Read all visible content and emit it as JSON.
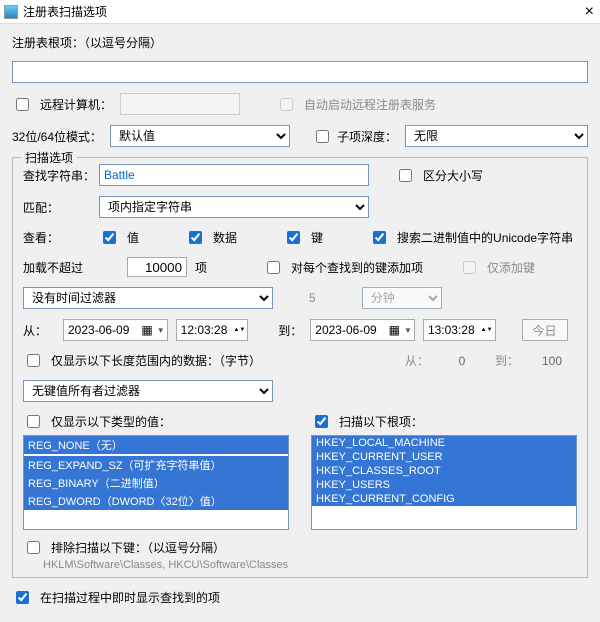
{
  "title": "注册表扫描选项",
  "root_label": "注册表根项：（以逗号分隔）",
  "root_value": "",
  "remote_label": "远程计算机：",
  "remote_value": "",
  "auto_remote_label": "自动启动远程注册表服务",
  "mode_label": "32位/64位模式：",
  "mode_value": "默认值",
  "child_depth_label": "子项深度：",
  "child_depth_value": "无限",
  "scan_group": "扫描选项",
  "search_label": "查找字符串：",
  "search_value": "Battle",
  "case_label": "区分大小写",
  "match_label": "匹配：",
  "match_value": "项内指定字符串",
  "look_label": "查看：",
  "look_values": "值",
  "look_data": "数据",
  "look_keys": "键",
  "unicode_label": "搜索二进制值中的Unicode字符串",
  "load_label": "加载不超过",
  "load_value": "10000",
  "load_unit": "项",
  "addkey_label": "对每个查找到的键添加项",
  "onlyadd_label": "仅添加键",
  "time_filter_value": "没有时间过滤器",
  "time_num": "5",
  "time_unit": "分钟",
  "from_label": "从：",
  "to_label": "到：",
  "date1": "2023-06-09",
  "time1": "12:03:28",
  "date2": "2023-06-09",
  "time2": "13:03:28",
  "today_btn": "今日",
  "size_label": "仅显示以下长度范围内的数据：（字节）",
  "size_from": "从：",
  "size_from_val": "0",
  "size_to": "到：",
  "size_to_val": "100",
  "owner_filter": "无键值所有者过滤器",
  "types_label": "仅显示以下类型的值：",
  "roots_label": "扫描以下根项：",
  "types": [
    "REG_NONE（无）",
    "",
    "REG_EXPAND_SZ（可扩充字符串值）",
    "REG_BINARY（二进制值）",
    "REG_DWORD（DWORD〈32位〉值）"
  ],
  "roots": [
    "HKEY_LOCAL_MACHINE",
    "HKEY_CURRENT_USER",
    "HKEY_CLASSES_ROOT",
    "HKEY_USERS",
    "HKEY_CURRENT_CONFIG"
  ],
  "exclude_label": "排除扫描以下键：（以逗号分隔）",
  "exclude_hint": "HKLM\\Software\\Classes, HKCU\\Software\\Classes",
  "live_label": "在扫描过程中即时显示查找到的项"
}
